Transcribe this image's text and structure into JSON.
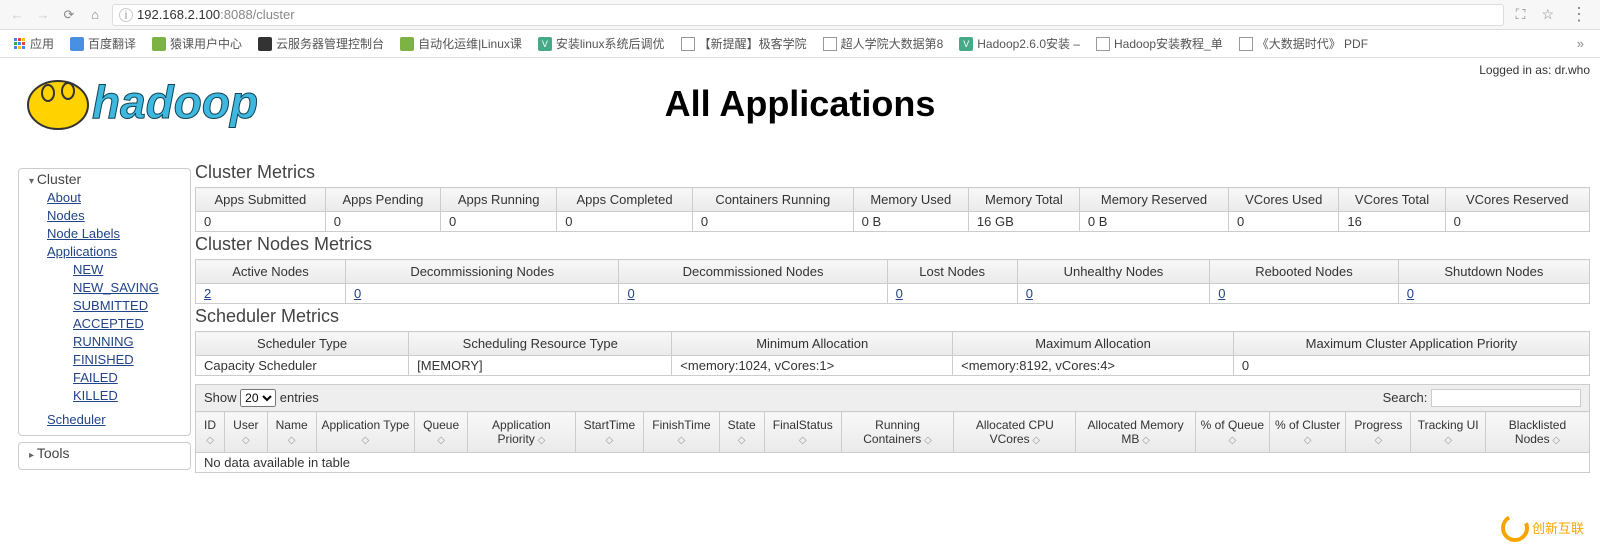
{
  "browser": {
    "url_host": "192.168.2.100",
    "url_port": ":8088",
    "url_path": "/cluster",
    "apps_label": "应用",
    "bookmarks": [
      {
        "label": "百度翻译",
        "cls": "ico-blue"
      },
      {
        "label": "猿课用户中心",
        "cls": "ico-green"
      },
      {
        "label": "云服务器管理控制台",
        "cls": "ico-black"
      },
      {
        "label": "自动化运维|Linux课",
        "cls": "ico-green"
      },
      {
        "label": "安装linux系统后调优",
        "cls": "ico-v",
        "txt": "V"
      },
      {
        "label": "【新提醒】极客学院",
        "cls": "ico-doc"
      },
      {
        "label": "超人学院大数据第8",
        "cls": "ico-doc"
      },
      {
        "label": "Hadoop2.6.0安装 –",
        "cls": "ico-v",
        "txt": "V"
      },
      {
        "label": "Hadoop安装教程_单",
        "cls": "ico-doc"
      },
      {
        "label": "《大数据时代》 PDF",
        "cls": "ico-doc"
      }
    ]
  },
  "page_title": "All Applications",
  "logged_in": "Logged in as: dr.who",
  "sidebar": {
    "cluster_title": "Cluster",
    "tools_title": "Tools",
    "links": [
      "About",
      "Nodes",
      "Node Labels",
      "Applications"
    ],
    "app_states": [
      "NEW",
      "NEW_SAVING",
      "SUBMITTED",
      "ACCEPTED",
      "RUNNING",
      "FINISHED",
      "FAILED",
      "KILLED"
    ],
    "scheduler": "Scheduler"
  },
  "cluster_metrics": {
    "title": "Cluster Metrics",
    "headers": [
      "Apps Submitted",
      "Apps Pending",
      "Apps Running",
      "Apps Completed",
      "Containers Running",
      "Memory Used",
      "Memory Total",
      "Memory Reserved",
      "VCores Used",
      "VCores Total",
      "VCores Reserved"
    ],
    "values": [
      "0",
      "0",
      "0",
      "0",
      "0",
      "0 B",
      "16 GB",
      "0 B",
      "0",
      "16",
      "0"
    ]
  },
  "nodes_metrics": {
    "title": "Cluster Nodes Metrics",
    "headers": [
      "Active Nodes",
      "Decommissioning Nodes",
      "Decommissioned Nodes",
      "Lost Nodes",
      "Unhealthy Nodes",
      "Rebooted Nodes",
      "Shutdown Nodes"
    ],
    "values": [
      "2",
      "0",
      "0",
      "0",
      "0",
      "0",
      "0"
    ]
  },
  "scheduler_metrics": {
    "title": "Scheduler Metrics",
    "headers": [
      "Scheduler Type",
      "Scheduling Resource Type",
      "Minimum Allocation",
      "Maximum Allocation",
      "Maximum Cluster Application Priority"
    ],
    "values": [
      "Capacity Scheduler",
      "[MEMORY]",
      "<memory:1024, vCores:1>",
      "<memory:8192, vCores:4>",
      "0"
    ]
  },
  "datatable": {
    "show_label_pre": "Show",
    "show_value": "20",
    "show_label_post": "entries",
    "search_label": "Search:",
    "columns": [
      "ID",
      "User",
      "Name",
      "Application Type",
      "Queue",
      "Application Priority",
      "StartTime",
      "FinishTime",
      "State",
      "FinalStatus",
      "Running Containers",
      "Allocated CPU VCores",
      "Allocated Memory MB",
      "% of Queue",
      "% of Cluster",
      "Progress",
      "Tracking UI",
      "Blacklisted Nodes"
    ],
    "no_data": "No data available in table"
  },
  "watermark": "创新互联"
}
